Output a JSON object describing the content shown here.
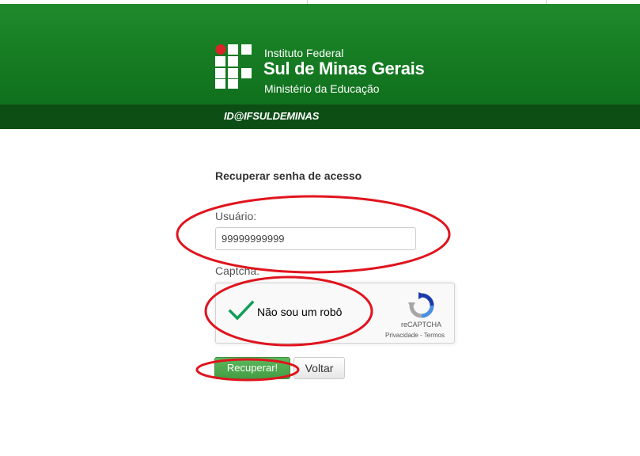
{
  "header": {
    "institute_line1": "Instituto Federal",
    "institute_line2": "Sul de Minas Gerais",
    "institute_line3": "Ministério da Educação",
    "subbar_label": "ID@IFSULDEMINAS",
    "colors": {
      "header_green": "#1f8a2c",
      "subbar_green": "#0d4e15",
      "logo_red": "#d9252a"
    }
  },
  "form": {
    "title": "Recuperar senha de acesso",
    "user_label": "Usuário:",
    "user_value": "99999999999",
    "captcha_label": "Captcha:",
    "recaptcha": {
      "checkbox_text": "Não sou um robô",
      "brand": "reCAPTCHA",
      "links": "Privacidade - Termos",
      "checked": true
    },
    "buttons": {
      "recover_label": "Recuperar!",
      "back_label": "Voltar"
    }
  },
  "annotations": {
    "color": "#e0141e"
  }
}
